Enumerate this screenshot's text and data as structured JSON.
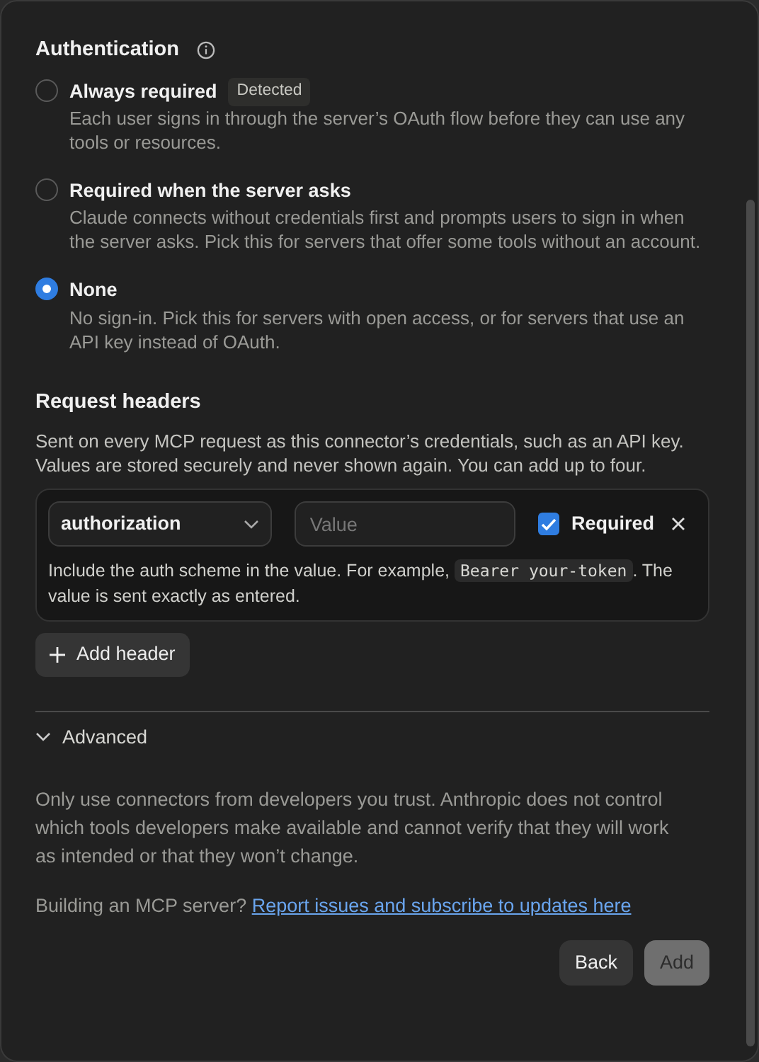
{
  "authentication": {
    "title": "Authentication",
    "options": [
      {
        "label": "Always required",
        "badge": "Detected",
        "description": "Each user signs in through the server’s OAuth flow before they can use any tools or resources.",
        "selected": false
      },
      {
        "label": "Required when the server asks",
        "description": "Claude connects without credentials first and prompts users to sign in when the server asks. Pick this for servers that offer some tools without an account.",
        "selected": false
      },
      {
        "label": "None",
        "description": "No sign-in. Pick this for servers with open access, or for servers that use an API key instead of OAuth.",
        "selected": true
      }
    ]
  },
  "request_headers": {
    "title": "Request headers",
    "description": "Sent on every MCP request as this connector’s credentials, such as an API key. Values are stored securely and never shown again. You can add up to four.",
    "headers": [
      {
        "name": "authorization",
        "value_placeholder": "Value",
        "required_label": "Required",
        "required": true,
        "hint_before": "Include the auth scheme in the value. For example, ",
        "hint_code": "Bearer your-token",
        "hint_after": ". The value is sent exactly as entered."
      }
    ],
    "add_button": "Add header"
  },
  "advanced": {
    "label": "Advanced",
    "expanded": true
  },
  "disclaimer": "Only use connectors from developers you trust. Anthropic does not control which tools developers make available and cannot verify that they will work as intended or that they won’t change.",
  "footer_note": {
    "text": "Building an MCP server?",
    "link": "Report issues and subscribe to updates here"
  },
  "buttons": [
    {
      "label": "Back",
      "disabled": false
    },
    {
      "label": "Add",
      "disabled": true
    }
  ]
}
